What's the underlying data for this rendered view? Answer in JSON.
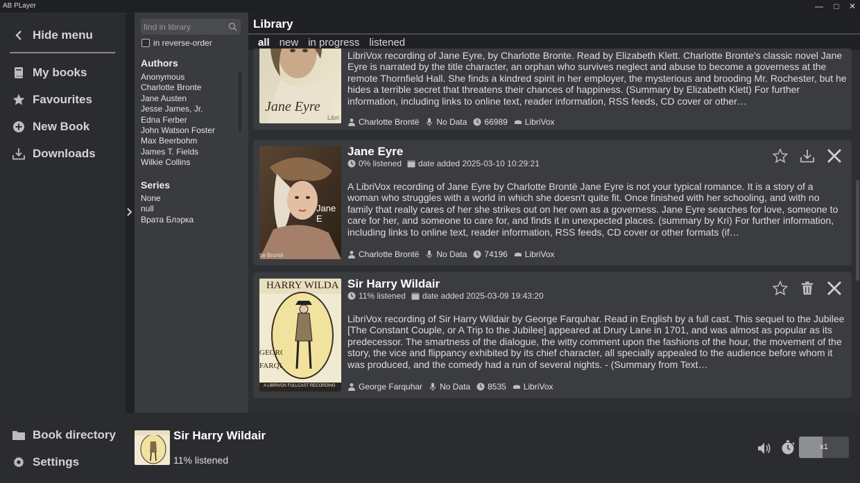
{
  "app": {
    "title": "AB PLayer",
    "window_controls": [
      "minimize",
      "maximize",
      "close"
    ]
  },
  "sidemenu": {
    "hide_menu": "Hide menu",
    "items": [
      {
        "label": "My books",
        "icon": "book-icon"
      },
      {
        "label": "Favourites",
        "icon": "star-icon"
      },
      {
        "label": "New Book",
        "icon": "plus-circle-icon"
      },
      {
        "label": "Downloads",
        "icon": "download-icon"
      }
    ],
    "bottom_items": [
      {
        "label": "Book directory",
        "icon": "folder-icon"
      },
      {
        "label": "Settings",
        "icon": "gear-icon"
      }
    ]
  },
  "filters": {
    "search_placeholder": "find in library",
    "reverse_order_label": "in reverse-order",
    "reverse_order_checked": false,
    "authors_heading": "Authors",
    "authors": [
      "Anonymous",
      "Charlotte Bronte",
      "Jane Austen",
      "Jesse James, Jr.",
      "Edna Ferber",
      "John Watson Foster",
      "Max Beerbohm",
      "James T. Fields",
      "Wilkie Collins"
    ],
    "series_heading": "Series",
    "series": [
      "None",
      "null",
      "Врата Блэрка"
    ]
  },
  "library": {
    "title": "Library",
    "tabs": [
      "all",
      "new",
      "in progress",
      "listened"
    ],
    "active_tab": "all",
    "books": [
      {
        "title": "",
        "cover_text": "Jane Eyre",
        "cover_sub": "Libri",
        "description": "LibriVox recording of Jane Eyre, by Charlotte Bronte. Read by Elizabeth Klett. Charlotte Bronte's classic novel Jane Eyre is narrated by the title character, an orphan who survives neglect and abuse to become a governess at the remote Thornfield Hall. She finds a kindred spirit in her employer, the mysterious and brooding Mr. Rochester, but he hides a terrible secret that threatens their chances of happiness. (Summary by Elizabeth Klett) For further information, including links to online text, reader information, RSS feeds, CD cover or other…",
        "author": "Charlotte Brontë",
        "narrator": "No Data",
        "duration": "66989",
        "publisher": "LibriVox"
      },
      {
        "title": "Jane Eyre",
        "cover_text": "Jane E",
        "cover_sub": "tte Brontë",
        "progress": "0% listened",
        "date_added": "date added 2025-03-10 10:29:21",
        "description": "A LibriVox recording of Jane Eyre by Charlotte Brontë Jane Eyre is not your typical romance. It is a story of a woman who struggles with a world in which she doesn't quite fit. Once finished with her schooling, and with no family that really cares of her she strikes out on her own as a governess. Jane Eyre searches for love, someone to care for her, and someone to care for, and finds it in unexpected places. (summary by Kri) For further information, including links to online text, reader information, RSS feeds, CD cover or other formats (if…",
        "author": "Charlotte Brontë",
        "narrator": "No Data",
        "duration": "74196",
        "publisher": "LibriVox",
        "actions": [
          "star-outline-icon",
          "download-icon",
          "close-icon"
        ]
      },
      {
        "title": "Sir Harry Wildair",
        "cover_text": "HARRY WILDA",
        "cover_sub": "A LIBRIVOX FULLCAST RECORDING",
        "cover_side": "GEORGE FARQUHAR",
        "progress": "11% listened",
        "date_added": "date added 2025-03-09 19:43:20",
        "description": "LibriVox recording of Sir Harry Wildair by George Farquhar. Read in English by a full cast. This sequel to the Jubilee [The Constant Couple, or A Trip to the Jubilee] appeared at Drury Lane in 1701, and was almost as popular as its predecessor. The smartness of the dialogue, the witty comment upon the fashions of the hour, the movement of the story, the vice and flippancy exhibited by its chief character, all specially appealed to the audience before whom it was produced, and the comedy had a run of several nights. - (Summary from Text…",
        "author": "George Farquhar",
        "narrator": "No Data",
        "duration": "8535",
        "publisher": "LibriVox",
        "actions": [
          "star-outline-icon",
          "trash-icon",
          "close-icon"
        ]
      }
    ]
  },
  "player": {
    "title": "Sir Harry Wildair",
    "progress": "11% listened",
    "speed": "x1",
    "speed_level": 0.47,
    "icons": [
      "volume-icon",
      "timer-icon"
    ]
  }
}
